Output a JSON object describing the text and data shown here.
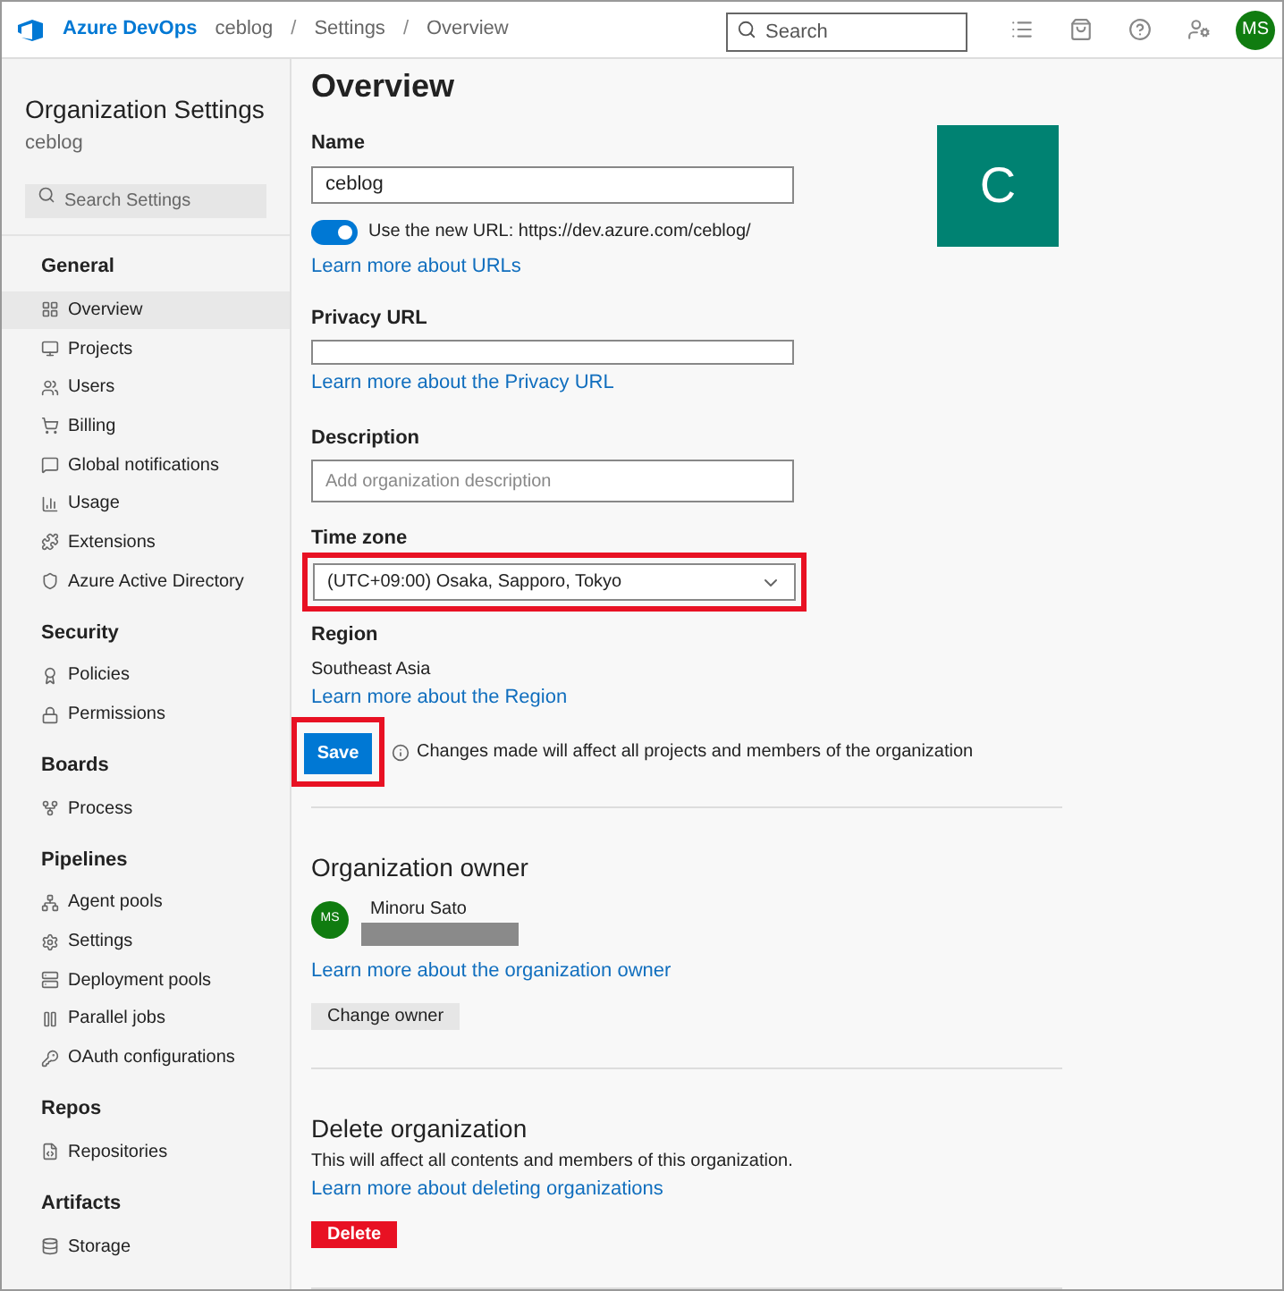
{
  "header": {
    "logo": "Azure DevOps",
    "breadcrumbs": [
      {
        "label": "ceblog",
        "separator": "/"
      },
      {
        "label": "Settings",
        "separator": "/"
      },
      {
        "label": "Overview"
      }
    ],
    "search": {
      "placeholder": "Search"
    },
    "avatar": "MS"
  },
  "sidebar": {
    "title": "Organization Settings",
    "subtitle": "ceblog",
    "search": {
      "placeholder": "Search Settings"
    },
    "sections": [
      {
        "heading": "General",
        "items": [
          {
            "label": "Overview",
            "selected": true
          },
          {
            "label": "Projects",
            "selected": false
          },
          {
            "label": "Users",
            "selected": false
          },
          {
            "label": "Billing",
            "selected": false
          },
          {
            "label": "Global notifications",
            "selected": false
          },
          {
            "label": "Usage",
            "selected": false
          },
          {
            "label": "Extensions",
            "selected": false
          },
          {
            "label": "Azure Active Directory",
            "selected": false
          }
        ]
      },
      {
        "heading": "Security",
        "items": [
          {
            "label": "Policies",
            "selected": false
          },
          {
            "label": "Permissions",
            "selected": false
          }
        ]
      },
      {
        "heading": "Boards",
        "items": [
          {
            "label": "Process",
            "selected": false
          }
        ]
      },
      {
        "heading": "Pipelines",
        "items": [
          {
            "label": "Agent pools",
            "selected": false
          },
          {
            "label": "Settings",
            "selected": false
          },
          {
            "label": "Deployment pools",
            "selected": false
          },
          {
            "label": "Parallel jobs",
            "selected": false
          },
          {
            "label": "OAuth configurations",
            "selected": false
          }
        ]
      },
      {
        "heading": "Repos",
        "items": [
          {
            "label": "Repositories",
            "selected": false
          }
        ]
      },
      {
        "heading": "Artifacts",
        "items": [
          {
            "label": "Storage",
            "selected": false
          }
        ]
      }
    ]
  },
  "main": {
    "title": "Overview",
    "org_tile": "C",
    "name": {
      "label": "Name",
      "value": "ceblog"
    },
    "new_url": {
      "on": true,
      "label": "Use the new URL: https://dev.azure.com/ceblog/",
      "link": "Learn more about URLs"
    },
    "privacy": {
      "label": "Privacy URL",
      "link": "Learn more about the Privacy URL"
    },
    "description": {
      "label": "Description",
      "placeholder": "Add organization description"
    },
    "time_zone": {
      "label": "Time zone",
      "value": "(UTC+09:00) Osaka, Sapporo, Tokyo",
      "highlighted": true
    },
    "region": {
      "label": "Region",
      "value": "Southeast Asia",
      "link": "Learn more about the Region"
    },
    "save": {
      "label": "Save",
      "highlighted": true,
      "note": "Changes made will affect all projects and members of the organization"
    },
    "owner": {
      "heading": "Organization owner",
      "avatar": "MS",
      "name": "Minoru Sato",
      "link": "Learn more about the organization owner",
      "button": "Change owner"
    },
    "delete": {
      "heading": "Delete organization",
      "text": "This will affect all contents and members of this organization.",
      "link": "Learn more about deleting organizations",
      "button": "Delete"
    }
  }
}
